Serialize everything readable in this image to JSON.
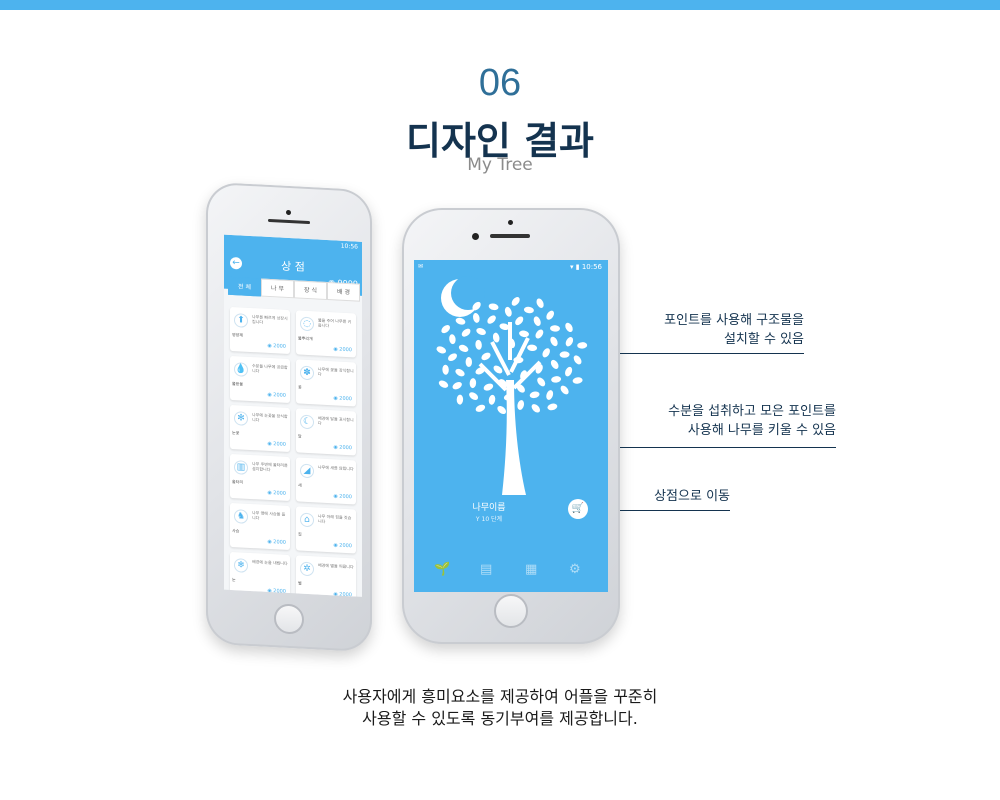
{
  "header": {
    "number": "06",
    "title": "디자인 결과",
    "subtitle": "My Tree"
  },
  "shop_screen": {
    "status_time": "10:56",
    "title": "상 점",
    "points": "9999",
    "tabs": [
      "전 체",
      "나 무",
      "장 식",
      "배 경"
    ],
    "items": [
      {
        "icon": "tree-icon",
        "glyph": "⬆",
        "name": "영양제",
        "desc": "나무를 빠르게 성장시킵니다",
        "price": "2000"
      },
      {
        "icon": "ring-icon",
        "glyph": "◌",
        "name": "물뿌리개",
        "desc": "물을 주어 나무를 키웁니다",
        "price": "2000"
      },
      {
        "icon": "drop-icon",
        "glyph": "💧",
        "name": "물방울",
        "desc": "수분을 나무에 공급합니다",
        "price": "2000"
      },
      {
        "icon": "flower-icon",
        "glyph": "✽",
        "name": "꽃",
        "desc": "나무에 꽃을 장식합니다",
        "price": "2000"
      },
      {
        "icon": "snowflake-icon",
        "glyph": "✻",
        "name": "눈꽃",
        "desc": "나무에 눈꽃을 장식합니다",
        "price": "2000"
      },
      {
        "icon": "moon-icon",
        "glyph": "☾",
        "name": "달",
        "desc": "배경에 달을 표시합니다",
        "price": "2000"
      },
      {
        "icon": "fence-icon",
        "glyph": "▥",
        "name": "울타리",
        "desc": "나무 주변에 울타리를 설치합니다",
        "price": "2000"
      },
      {
        "icon": "bird-icon",
        "glyph": "◢",
        "name": "새",
        "desc": "나무에 새를 앉힙니다",
        "price": "2000"
      },
      {
        "icon": "deer-icon",
        "glyph": "♞",
        "name": "사슴",
        "desc": "나무 옆에 사슴을 둡니다",
        "price": "2000"
      },
      {
        "icon": "house-icon",
        "glyph": "⌂",
        "name": "집",
        "desc": "나무 아래 집을 짓습니다",
        "price": "2000"
      },
      {
        "icon": "snow-icon",
        "glyph": "❄",
        "name": "눈",
        "desc": "배경에 눈을 내립니다",
        "price": "2000"
      },
      {
        "icon": "star-icon",
        "glyph": "✲",
        "name": "별",
        "desc": "배경에 별을 띄웁니다",
        "price": "2000"
      }
    ]
  },
  "tree_screen": {
    "status_time": "10:56",
    "tree_name": "나무이름",
    "level": "10 단계",
    "nav": [
      "sprout-icon",
      "cup-icon",
      "calendar-icon",
      "gear-icon"
    ]
  },
  "callouts": [
    {
      "text": "포인트를 사용해 구조물을\n설치할 수 있음"
    },
    {
      "text": "수분을 섭취하고 모은 포인트를\n사용해 나무를 키울 수 있음"
    },
    {
      "text": "상점으로 이동"
    }
  ],
  "footer": {
    "line1": "사용자에게 흥미요소를 제공하여 어플을 꾸준히",
    "line2": "사용할 수 있도록 동기부여를 제공합니다."
  },
  "colors": {
    "accent": "#4db3ee",
    "title": "#14334f",
    "number": "#2f6f98"
  }
}
